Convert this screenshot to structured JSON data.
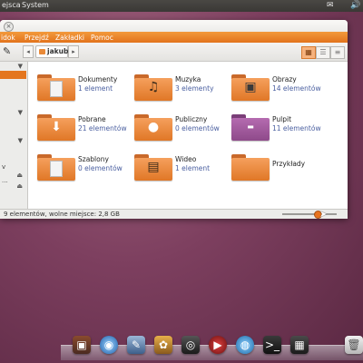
{
  "top_panel": {
    "menu_places": "ejsca",
    "menu_system": "System"
  },
  "window": {
    "menu": [
      "idok",
      "Przejdź",
      "Zakładki",
      "Pomoc"
    ],
    "breadcrumb": "jakub",
    "view_modes": [
      "icon-view",
      "list-view",
      "compact-view"
    ]
  },
  "folders": [
    {
      "name": "Dokumenty",
      "count": "1 element",
      "icon": "documents-icon",
      "color": "orange"
    },
    {
      "name": "Muzyka",
      "count": "3 elementy",
      "icon": "music-icon",
      "color": "orange"
    },
    {
      "name": "Obrazy",
      "count": "14 elementów",
      "icon": "pictures-icon",
      "color": "orange"
    },
    {
      "name": "Pobrane",
      "count": "21 elementów",
      "icon": "download-icon",
      "color": "orange"
    },
    {
      "name": "Publiczny",
      "count": "0 elementów",
      "icon": "public-user-icon",
      "color": "orange"
    },
    {
      "name": "Pulpit",
      "count": "11 elementów",
      "icon": "desktop-icon",
      "color": "purple"
    },
    {
      "name": "Szablony",
      "count": "0 elementów",
      "icon": "templates-icon",
      "color": "orange"
    },
    {
      "name": "Wideo",
      "count": "1 element",
      "icon": "video-icon",
      "color": "orange"
    },
    {
      "name": "Przykłady",
      "count": "",
      "icon": "examples-icon",
      "color": "orange"
    }
  ],
  "statusbar": {
    "text": "9 elementów, wolne miejsce: 2,8 GB",
    "zoom_level": 0.58
  },
  "sidebar": {
    "label_v": "v",
    "label_dots": "..."
  },
  "colors": {
    "accent": "#e4761f",
    "link_count": "#4a5fa0",
    "desktop_bg": "#7d3f5f"
  },
  "dock": [
    "desktop-app-icon",
    "firefox-icon",
    "bug-icon",
    "image-editor-icon",
    "camera-icon",
    "media-player-icon",
    "globe-icon",
    "terminal-icon",
    "clapperboard-icon",
    "trash-icon"
  ]
}
